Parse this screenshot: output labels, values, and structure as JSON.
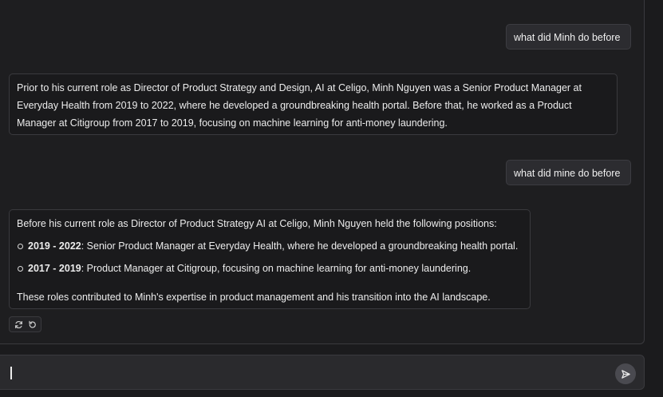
{
  "messages": {
    "user_1": "what did Minh do before",
    "assistant_1": "Prior to his current role as Director of Product Strategy and Design, AI at Celigo, Minh Nguyen was a Senior Product Manager at Everyday Health from 2019 to 2022, where he developed a groundbreaking health portal. Before that, he worked as a Product Manager at Citigroup from 2017 to 2019, focusing on machine learning for anti-money laundering.",
    "user_2": "what did mine do before",
    "assistant_2": {
      "intro": "Before his current role as Director of Product Strategy AI at Celigo, Minh Nguyen held the following positions:",
      "items": [
        {
          "period": "2019 - 2022",
          "text": ": Senior Product Manager at Everyday Health, where he developed a groundbreaking health portal."
        },
        {
          "period": "2017 - 2019",
          "text": ": Product Manager at Citigroup, focusing on machine learning for anti-money laundering."
        }
      ],
      "outro": "These roles contributed to Minh's expertise in product management and his transition into the AI landscape."
    }
  },
  "actions": {
    "regenerate_icon": "refresh-icon",
    "undo_icon": "undo-icon"
  },
  "composer": {
    "value": "",
    "placeholder": "",
    "send_icon": "send-icon"
  }
}
